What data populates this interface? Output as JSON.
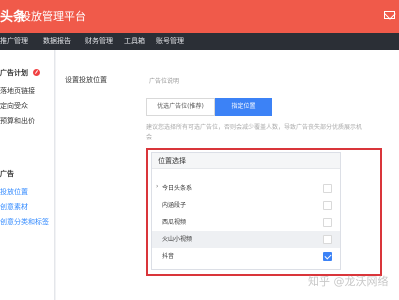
{
  "header": {
    "logo": "头条",
    "platform_title": "投放管理平台",
    "mail_icon": "mail-icon"
  },
  "nav": [
    "推广管理",
    "数据报告",
    "财务管理",
    "工具箱",
    "账号管理"
  ],
  "sidebar": {
    "items": [
      {
        "label": "广告计划",
        "style": "head"
      },
      {
        "label": "落地页链接",
        "style": "normal"
      },
      {
        "label": "定向受众",
        "style": "normal"
      },
      {
        "label": "预算和出价",
        "style": "normal"
      },
      {
        "label": "广告",
        "style": "head"
      },
      {
        "label": "投放位置",
        "style": "sub"
      },
      {
        "label": "创意素材",
        "style": "sub"
      },
      {
        "label": "创意分类和标签",
        "style": "sub"
      }
    ],
    "badge_color": "#f04142"
  },
  "main": {
    "section_label": "设置投放位置",
    "description_label": "广告位说明",
    "placement_options": {
      "optimized": "优选广告位(推荐)",
      "specified": "指定位置"
    },
    "tip": "建议您选择所有可选广告位，否则会减少覆盖人数，导致广告丧失部分优质展示机会",
    "panel": {
      "title": "位置选择",
      "items": [
        {
          "label": "今日头条系",
          "expandable": true,
          "checked": false
        },
        {
          "label": "内涵段子",
          "expandable": false,
          "checked": false
        },
        {
          "label": "西瓜视频",
          "expandable": false,
          "checked": false
        },
        {
          "label": "火山小视频",
          "expandable": false,
          "checked": false
        },
        {
          "label": "抖音",
          "expandable": false,
          "checked": true
        }
      ]
    }
  },
  "watermark": "知乎 @龙沃网络",
  "colors": {
    "header": "#f05a4a",
    "navbar": "#2b2f36",
    "accent": "#3c82f6",
    "highlight_frame": "#d9353a"
  }
}
